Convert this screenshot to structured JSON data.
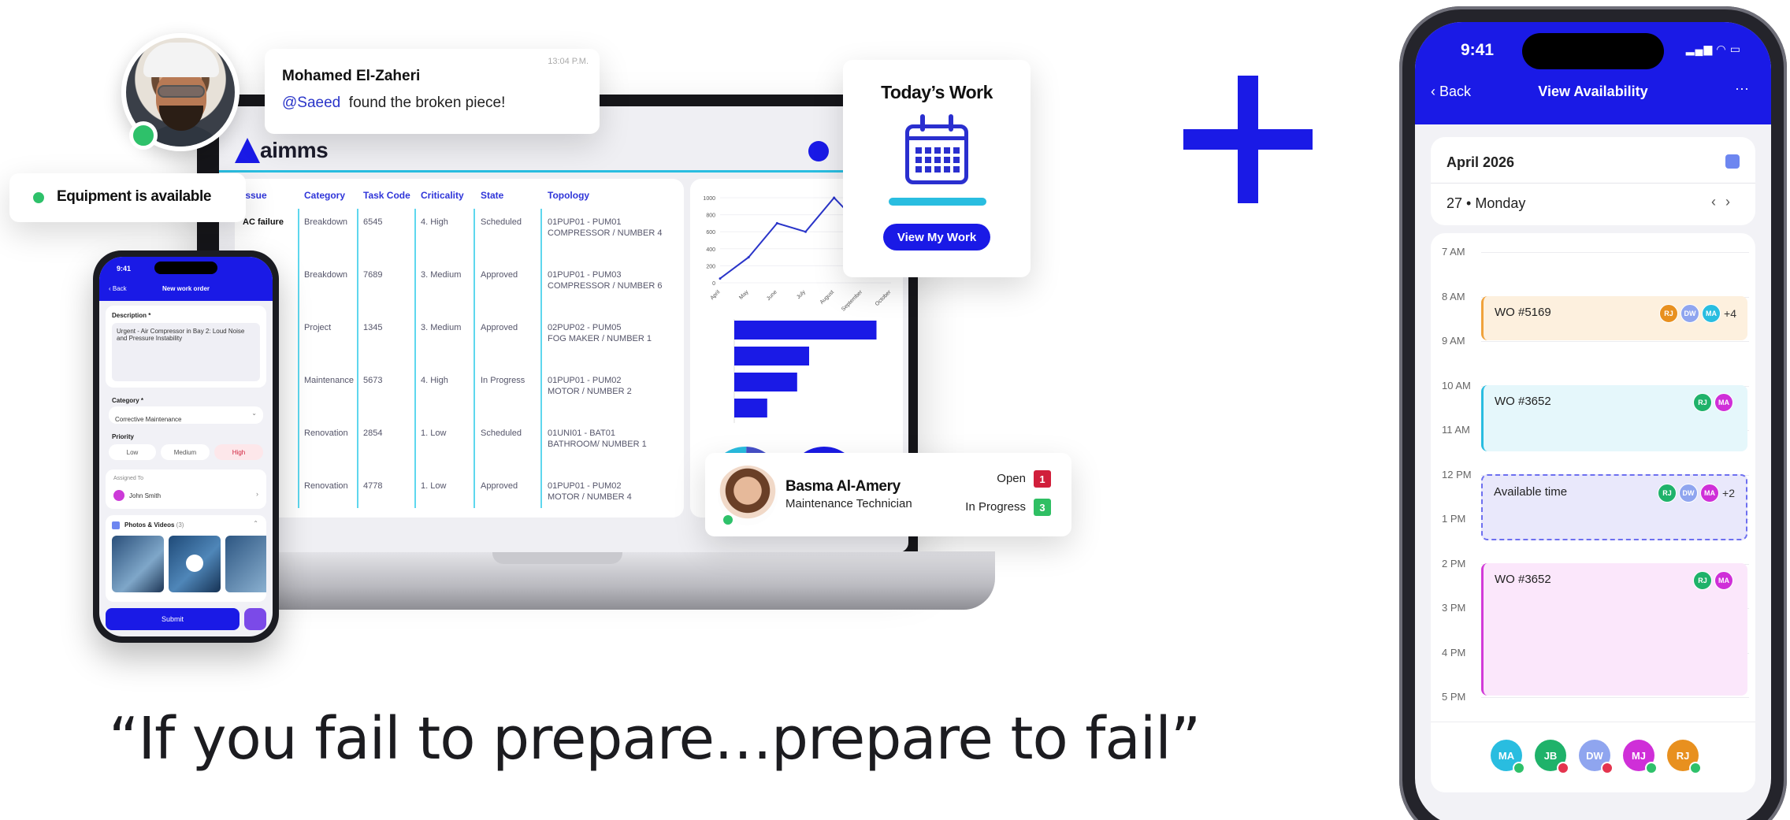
{
  "message": {
    "time": "13:04 P.M.",
    "name": "Mohamed El-Zaheri",
    "mention": "@Saeed",
    "text": "found the broken piece!"
  },
  "equipment_status": "Equipment is available",
  "app": {
    "logo": "aimms",
    "table": {
      "headers": [
        "Issue",
        "Category",
        "Task Code",
        "Criticality",
        "State",
        "Topology"
      ],
      "rows": [
        {
          "issue": "AC failure",
          "category": "Breakdown",
          "code": "6545",
          "criticality": "4. High",
          "state": "Scheduled",
          "topology1": "01PUP01 - PUM01",
          "topology2": "COMPRESSOR / NUMBER 4"
        },
        {
          "issue": "",
          "category": "Breakdown",
          "code": "7689",
          "criticality": "3. Medium",
          "state": "Approved",
          "topology1": "01PUP01 - PUM03",
          "topology2": "COMPRESSOR / NUMBER 6"
        },
        {
          "issue": "",
          "category": "Project",
          "code": "1345",
          "criticality": "3. Medium",
          "state": "Approved",
          "topology1": "02PUP02 - PUM05",
          "topology2": "FOG MAKER / NUMBER 1"
        },
        {
          "issue": "p",
          "category": "Maintenance",
          "code": "5673",
          "criticality": "4. High",
          "state": "In Progress",
          "topology1": "01PUP01 - PUM02",
          "topology2": "MOTOR / NUMBER 2"
        },
        {
          "issue": "",
          "category": "Renovation",
          "code": "2854",
          "criticality": "1. Low",
          "state": "Scheduled",
          "topology1": "01UNI01 - BAT01",
          "topology2": "BATHROOM/ NUMBER 1"
        },
        {
          "issue": "",
          "category": "Renovation",
          "code": "4778",
          "criticality": "1. Low",
          "state": "Approved",
          "topology1": "01PUP01 - PUM02",
          "topology2": "MOTOR / NUMBER 4"
        }
      ]
    }
  },
  "chart_data": [
    {
      "type": "line",
      "x": [
        "April",
        "May",
        "June",
        "July",
        "August",
        "September",
        "October"
      ],
      "values": [
        50,
        300,
        700,
        600,
        1000,
        650,
        800
      ],
      "ylim": [
        0,
        1000
      ],
      "yticks": [
        "0",
        "200",
        "400",
        "600",
        "800",
        "1000"
      ]
    },
    {
      "type": "bar",
      "orientation": "horizontal",
      "values": [
        95,
        50,
        42,
        22
      ]
    }
  ],
  "todays_work": {
    "title": "Today’s Work",
    "button": "View My Work"
  },
  "technician": {
    "name": "Basma Al-Amery",
    "role": "Maintenance Technician",
    "open_label": "Open",
    "open_count": "1",
    "progress_label": "In Progress",
    "progress_count": "3",
    "open_color": "#d11f3b",
    "progress_color": "#2fbf63"
  },
  "small_phone": {
    "time": "9:41",
    "back": "Back",
    "title": "New work order",
    "description_label": "Description *",
    "description_text": "Urgent - Air Compressor in Bay 2: Loud Noise and Pressure Instability",
    "category_label": "Category *",
    "category_value": "Corrective Maintenance",
    "priority_label": "Priority",
    "priority_low": "Low",
    "priority_medium": "Medium",
    "priority_high": "High",
    "assigned_label": "Assigned To",
    "assigned_value": "John Smith",
    "photos_label": "Photos & Videos",
    "photos_count": "(3)",
    "submit": "Submit"
  },
  "quote": "“If you fail to prepare…prepare to fail”",
  "big_phone": {
    "time": "9:41",
    "back": "Back",
    "title": "View Availability",
    "more": "···",
    "month": "April 2026",
    "day": "27 • Monday",
    "hours": [
      "7 AM",
      "8 AM",
      "9 AM",
      "10 AM",
      "11 AM",
      "12 PM",
      "1 PM",
      "2 PM",
      "3 PM",
      "4 PM",
      "5 PM"
    ],
    "events": [
      {
        "label": "WO #5169",
        "more": "+4"
      },
      {
        "label": "WO #3652",
        "more": ""
      },
      {
        "label": "Available time",
        "more": "+2"
      },
      {
        "label": "WO #3652",
        "more": ""
      }
    ],
    "footer_initials": [
      "MA",
      "JB",
      "DW",
      "MJ",
      "RJ"
    ]
  },
  "colors": {
    "brand_blue": "#1a1ae6",
    "accent_cyan": "#29bde0",
    "online_green": "#2ec16a"
  }
}
